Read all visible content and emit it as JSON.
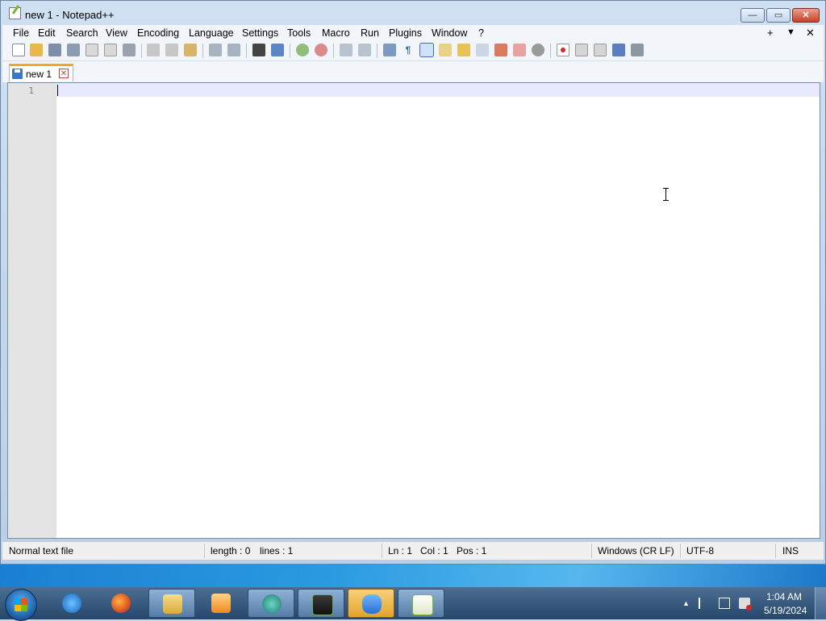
{
  "window": {
    "title": "new 1 - Notepad++",
    "controls": {
      "minimize": "—",
      "maximize": "▭",
      "close": "✕"
    }
  },
  "menu": {
    "items": [
      "File",
      "Edit",
      "Search",
      "View",
      "Encoding",
      "Language",
      "Settings",
      "Tools",
      "Macro",
      "Run",
      "Plugins",
      "Window",
      "?"
    ],
    "right": {
      "add": "+",
      "dropdown": "▼",
      "close": "✕"
    }
  },
  "toolbar": {
    "icons": [
      "new-file-icon",
      "open-file-icon",
      "save-icon",
      "save-all-icon",
      "close-icon",
      "close-all-icon",
      "print-icon",
      "cut-icon",
      "copy-icon",
      "paste-icon",
      "undo-icon",
      "redo-icon",
      "find-icon",
      "replace-icon",
      "zoom-in-icon",
      "zoom-out-icon",
      "sync-vertical-icon",
      "sync-horizontal-icon",
      "word-wrap-icon",
      "show-all-chars-icon",
      "indent-guide-icon",
      "user-language-icon",
      "doc-map-icon",
      "doc-list-icon",
      "function-list-icon",
      "folder-workspace-icon",
      "monitoring-icon",
      "macro-record-icon",
      "macro-stop-icon",
      "macro-play-icon",
      "macro-run-multiple-icon",
      "macro-save-icon"
    ]
  },
  "tabs": [
    {
      "label": "new 1",
      "close": "✕"
    }
  ],
  "editor": {
    "line_numbers": [
      "1"
    ],
    "content": ""
  },
  "status": {
    "file_type": "Normal text file",
    "length": "length : 0",
    "lines": "lines : 1",
    "ln": "Ln : 1",
    "col": "Col : 1",
    "pos": "Pos : 1",
    "eol": "Windows (CR LF)",
    "encoding": "UTF-8",
    "mode": "INS"
  },
  "taskbar": {
    "apps": [
      "internet-explorer-icon",
      "firefox-icon",
      "file-explorer-icon",
      "media-player-icon",
      "media-center-icon",
      "task-manager-icon",
      "messenger-icon",
      "notepad-plus-plus-icon"
    ],
    "tray": {
      "up_arrow": "▲"
    },
    "clock": {
      "time": "1:04 AM",
      "date": "5/19/2024"
    }
  },
  "colors": {
    "current_line": "#e8e8ff",
    "gutter": "#e4e4e4",
    "tab_accent": "#f5a623"
  }
}
